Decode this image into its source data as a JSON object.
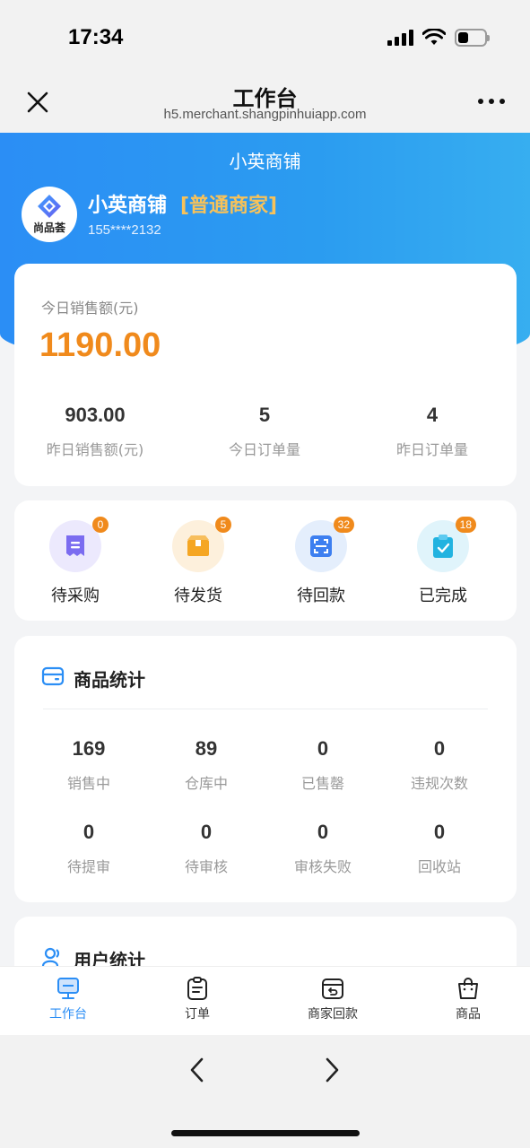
{
  "status_bar": {
    "time": "17:34",
    "battery_level": 0.4
  },
  "nav": {
    "title": "工作台",
    "url": "h5.merchant.shangpinhuiapp.com"
  },
  "shop": {
    "header_title": "小英商铺",
    "name": "小英商铺",
    "tier": "[普通商家]",
    "phone": "155****2132",
    "logo_caption": "尚品荟"
  },
  "sales": {
    "today_label": "今日销售额(元)",
    "today_amount": "1190.00",
    "stats": [
      {
        "value": "903.00",
        "label": "昨日销售额(元)"
      },
      {
        "value": "5",
        "label": "今日订单量"
      },
      {
        "value": "4",
        "label": "昨日订单量"
      }
    ]
  },
  "orders": [
    {
      "label": "待采购",
      "badge": "0",
      "icon": "receipt-icon",
      "color": "#7b6cf0",
      "bg": "#ece9fd"
    },
    {
      "label": "待发货",
      "badge": "5",
      "icon": "box-icon",
      "color": "#f5a623",
      "bg": "#fdf0dc"
    },
    {
      "label": "待回款",
      "badge": "32",
      "icon": "scan-icon",
      "color": "#3d7ff0",
      "bg": "#e4eefc"
    },
    {
      "label": "已完成",
      "badge": "18",
      "icon": "clipboard-check-icon",
      "color": "#22b3e0",
      "bg": "#e0f4fb"
    }
  ],
  "product_stats": {
    "title": "商品统计",
    "items": [
      {
        "value": "169",
        "label": "销售中"
      },
      {
        "value": "89",
        "label": "仓库中"
      },
      {
        "value": "0",
        "label": "已售罄"
      },
      {
        "value": "0",
        "label": "违规次数"
      },
      {
        "value": "0",
        "label": "待提审"
      },
      {
        "value": "0",
        "label": "待审核"
      },
      {
        "value": "0",
        "label": "审核失败"
      },
      {
        "value": "0",
        "label": "回收站"
      }
    ]
  },
  "user_stats": {
    "title": "用户统计"
  },
  "tabs": [
    {
      "label": "工作台",
      "icon": "monitor-icon",
      "active": true
    },
    {
      "label": "订单",
      "icon": "clipboard-icon",
      "active": false
    },
    {
      "label": "商家回款",
      "icon": "refund-icon",
      "active": false
    },
    {
      "label": "商品",
      "icon": "bag-icon",
      "active": false
    }
  ],
  "colors": {
    "brand_blue": "#2b8ef5",
    "amount_orange": "#f08a1c",
    "tier_gold": "#f7c25a"
  }
}
